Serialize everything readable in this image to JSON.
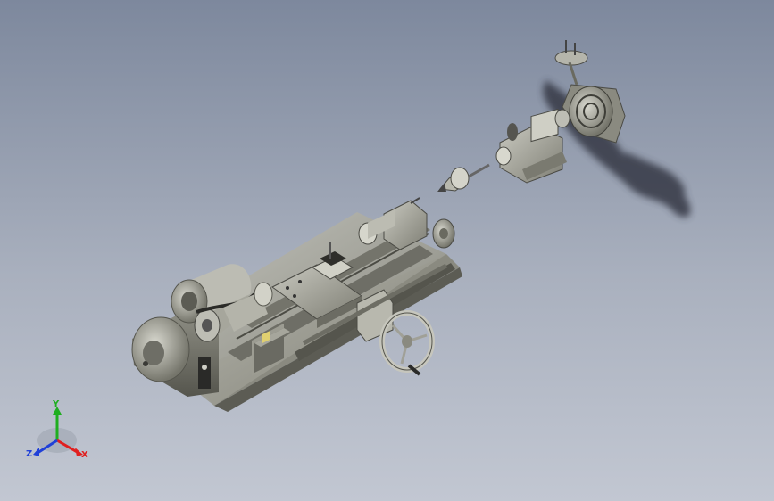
{
  "triad": {
    "x_label": "X",
    "y_label": "Y",
    "z_label": "Z",
    "x_color": "#e02020",
    "y_color": "#1fae1f",
    "z_color": "#2040d8"
  },
  "model": {
    "body_color": "#9a9a8f",
    "shadow_color": "#3a3e48"
  }
}
